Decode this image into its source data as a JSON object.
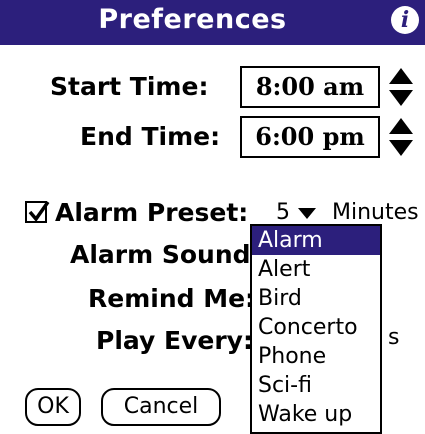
{
  "title": "Preferences",
  "info_icon": "i",
  "start_time": {
    "label": "Start Time:",
    "value": "8:00 am"
  },
  "end_time": {
    "label": "End Time:",
    "value": "6:00 pm"
  },
  "alarm_preset": {
    "label": "Alarm Preset:",
    "checked": true,
    "value": "5",
    "unit": "Minutes"
  },
  "alarm_sound": {
    "label": "Alarm Sound:"
  },
  "remind_me": {
    "label": "Remind Me:"
  },
  "play_every": {
    "label": "Play Every:",
    "trailing": "s"
  },
  "buttons": {
    "ok": "OK",
    "cancel": "Cancel"
  },
  "sound_popup": {
    "items": [
      "Alarm",
      "Alert",
      "Bird",
      "Concerto",
      "Phone",
      "Sci-fi",
      "Wake up"
    ],
    "selected": "Alarm"
  },
  "colors": {
    "title_bg": "#2c1f7c",
    "selection_bg": "#2c1f7c"
  }
}
